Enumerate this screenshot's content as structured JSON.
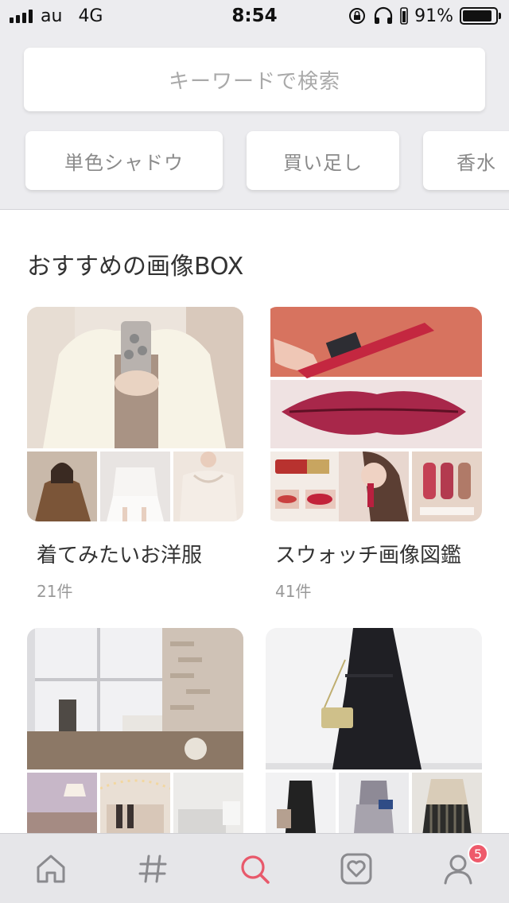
{
  "status_bar": {
    "carrier": "au",
    "network": "4G",
    "time": "8:54",
    "battery": "91%",
    "battery_level": 0.91
  },
  "search": {
    "placeholder": "キーワードで検索"
  },
  "chips": [
    {
      "label": "単色シャドウ"
    },
    {
      "label": "買い足し"
    },
    {
      "label": "香水"
    }
  ],
  "section": {
    "title": "おすすめの画像BOX"
  },
  "boxes": [
    {
      "title": "着てみたいお洋服",
      "count": "21件"
    },
    {
      "title": "スウォッチ画像図鑑",
      "count": "41件"
    },
    {
      "title": "",
      "count": ""
    },
    {
      "title": "",
      "count": ""
    }
  ],
  "tabs": {
    "home": "home-icon",
    "hashtag": "hashtag-icon",
    "search": "search-icon",
    "favorites": "heart-icon",
    "profile": "user-icon",
    "profile_badge": "5"
  },
  "colors": {
    "accent": "#e8596b",
    "badge": "#ee5a6b",
    "background_gray": "#ececef",
    "tab_icon": "#8a8a8e"
  }
}
